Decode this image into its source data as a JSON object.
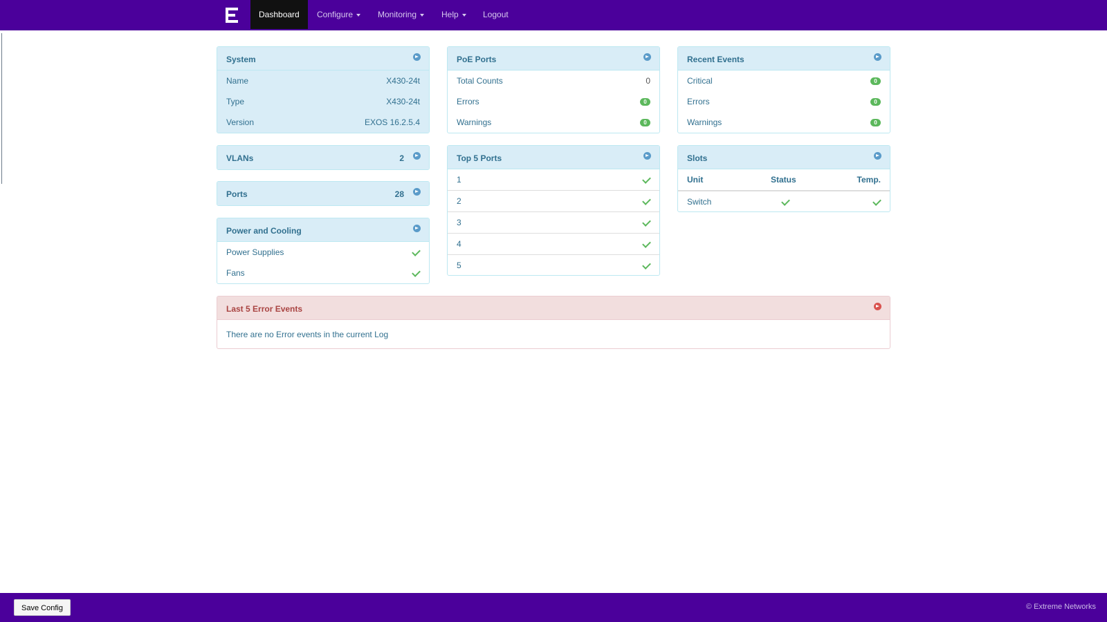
{
  "nav": {
    "items": [
      {
        "label": "Dashboard",
        "active": true
      },
      {
        "label": "Configure",
        "dropdown": true
      },
      {
        "label": "Monitoring",
        "dropdown": true
      },
      {
        "label": "Help",
        "dropdown": true
      },
      {
        "label": "Logout",
        "dropdown": false
      }
    ]
  },
  "system": {
    "title": "System",
    "rows": [
      {
        "label": "Name",
        "value": "X430-24t"
      },
      {
        "label": "Type",
        "value": "X430-24t"
      },
      {
        "label": "Version",
        "value": "EXOS 16.2.5.4"
      }
    ]
  },
  "vlans": {
    "title": "VLANs",
    "count": "2"
  },
  "ports": {
    "title": "Ports",
    "count": "28"
  },
  "power": {
    "title": "Power and Cooling",
    "rows": [
      {
        "label": "Power Supplies",
        "status": "ok"
      },
      {
        "label": "Fans",
        "status": "ok"
      }
    ]
  },
  "poe": {
    "title": "PoE Ports",
    "total_label": "Total Counts",
    "total_value": "0",
    "errors_label": "Errors",
    "errors_value": "0",
    "warnings_label": "Warnings",
    "warnings_value": "0"
  },
  "top_ports": {
    "title": "Top 5 Ports",
    "rows": [
      "1",
      "2",
      "3",
      "4",
      "5"
    ]
  },
  "recent_events": {
    "title": "Recent Events",
    "rows": [
      {
        "label": "Critical",
        "value": "0"
      },
      {
        "label": "Errors",
        "value": "0"
      },
      {
        "label": "Warnings",
        "value": "0"
      }
    ]
  },
  "slots": {
    "title": "Slots",
    "col_unit": "Unit",
    "col_status": "Status",
    "col_temp": "Temp.",
    "rows": [
      {
        "unit": "Switch",
        "status": "ok",
        "temp": "ok"
      }
    ]
  },
  "errors_panel": {
    "title": "Last 5 Error Events",
    "message": "There are no Error events in the current Log"
  },
  "footer": {
    "save_label": "Save Config",
    "copyright": "© Extreme Networks"
  },
  "colors": {
    "brand": "#4b009b",
    "panel_head": "#d9edf7",
    "badge": "#5cb85c",
    "error_head": "#f2dede"
  }
}
